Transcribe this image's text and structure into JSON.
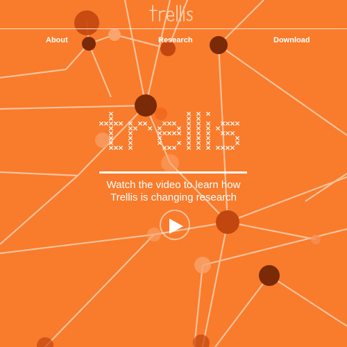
{
  "site": {
    "logo_text": "trellis",
    "hero_logo_text": "trellis"
  },
  "nav": {
    "items": [
      {
        "label": "About"
      },
      {
        "label": "Research"
      },
      {
        "label": "Download"
      }
    ]
  },
  "hero": {
    "tagline_line1": "Watch the video to learn how",
    "tagline_line2": "Trellis is changing research"
  },
  "colors": {
    "background": "#f97b2c",
    "node_dark": "#7a2a06",
    "node_mid": "#c2460f",
    "node_light": "#f9a46e",
    "line": "#fbd0b0",
    "text": "#ffffff"
  },
  "icons": {
    "play": "play-icon"
  }
}
